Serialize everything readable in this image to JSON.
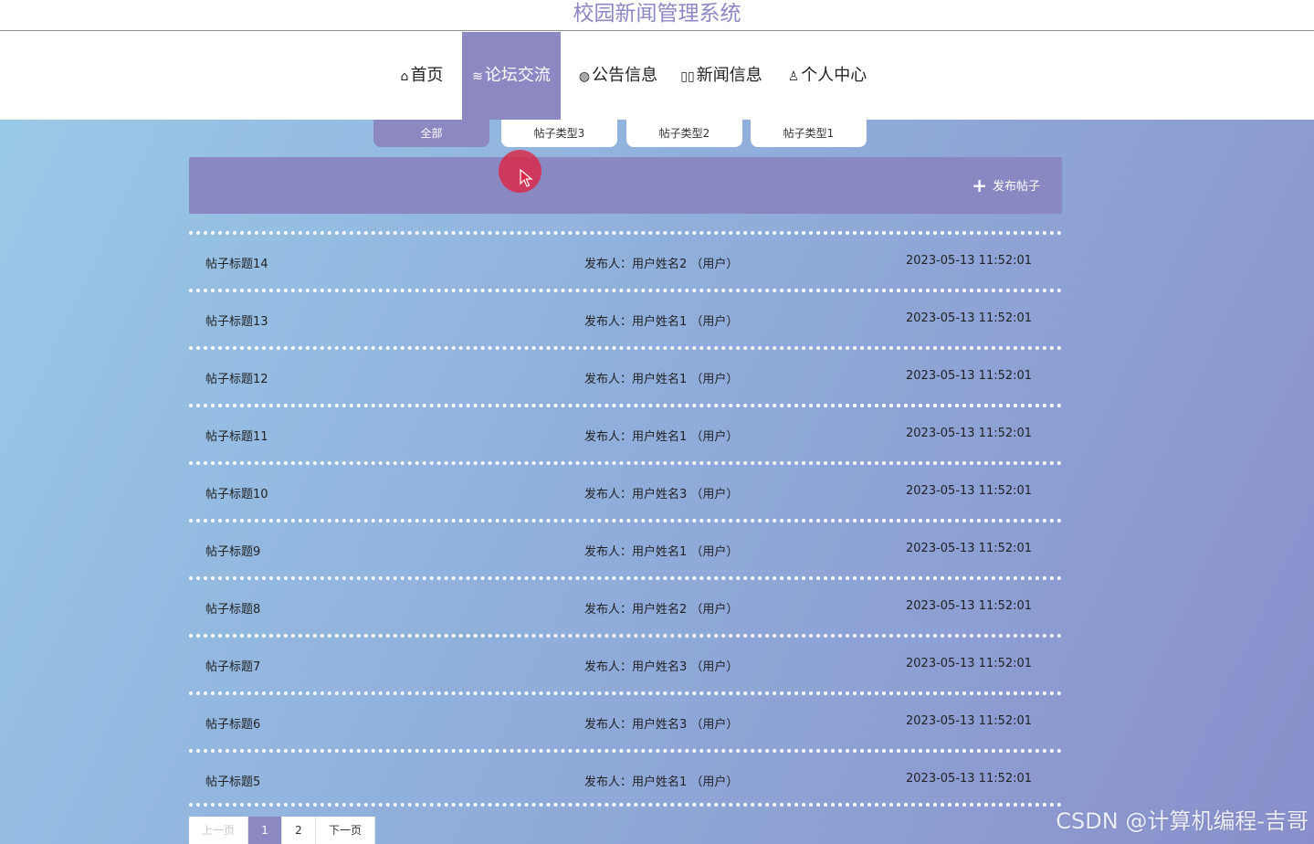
{
  "header": {
    "site_title": "校园新闻管理系统"
  },
  "nav": {
    "items": [
      {
        "label": "首页",
        "icon": "home-icon",
        "glyph": "⌂"
      },
      {
        "label": "论坛交流",
        "icon": "book-stack-icon",
        "glyph": "≋"
      },
      {
        "label": "公告信息",
        "icon": "bell-icon",
        "glyph": "◍"
      },
      {
        "label": "新闻信息",
        "icon": "news-icon",
        "glyph": "▯▯"
      },
      {
        "label": "个人中心",
        "icon": "user-icon",
        "glyph": "♙"
      }
    ],
    "active_index": 1
  },
  "category_tabs": {
    "items": [
      "全部",
      "帖子类型3",
      "帖子类型2",
      "帖子类型1"
    ],
    "active_index": 0
  },
  "toolbar": {
    "publish_label": "发布帖子"
  },
  "posts": [
    {
      "title": "帖子标题14",
      "author": "发布人：用户姓名2 （用户）",
      "time": "2023-05-13 11:52:01"
    },
    {
      "title": "帖子标题13",
      "author": "发布人：用户姓名1 （用户）",
      "time": "2023-05-13 11:52:01"
    },
    {
      "title": "帖子标题12",
      "author": "发布人：用户姓名1 （用户）",
      "time": "2023-05-13 11:52:01"
    },
    {
      "title": "帖子标题11",
      "author": "发布人：用户姓名1 （用户）",
      "time": "2023-05-13 11:52:01"
    },
    {
      "title": "帖子标题10",
      "author": "发布人：用户姓名3 （用户）",
      "time": "2023-05-13 11:52:01"
    },
    {
      "title": "帖子标题9",
      "author": "发布人：用户姓名1 （用户）",
      "time": "2023-05-13 11:52:01"
    },
    {
      "title": "帖子标题8",
      "author": "发布人：用户姓名2 （用户）",
      "time": "2023-05-13 11:52:01"
    },
    {
      "title": "帖子标题7",
      "author": "发布人：用户姓名3 （用户）",
      "time": "2023-05-13 11:52:01"
    },
    {
      "title": "帖子标题6",
      "author": "发布人：用户姓名3 （用户）",
      "time": "2023-05-13 11:52:01"
    },
    {
      "title": "帖子标题5",
      "author": "发布人：用户姓名1 （用户）",
      "time": "2023-05-13 11:52:01"
    }
  ],
  "pagination": {
    "prev_label": "上一页",
    "pages": [
      "1",
      "2"
    ],
    "current_page": "1",
    "next_label": "下一页"
  },
  "watermark": "CSDN @计算机编程-吉哥",
  "colors": {
    "accent": "#8c88c1",
    "title": "#8b88c3"
  }
}
